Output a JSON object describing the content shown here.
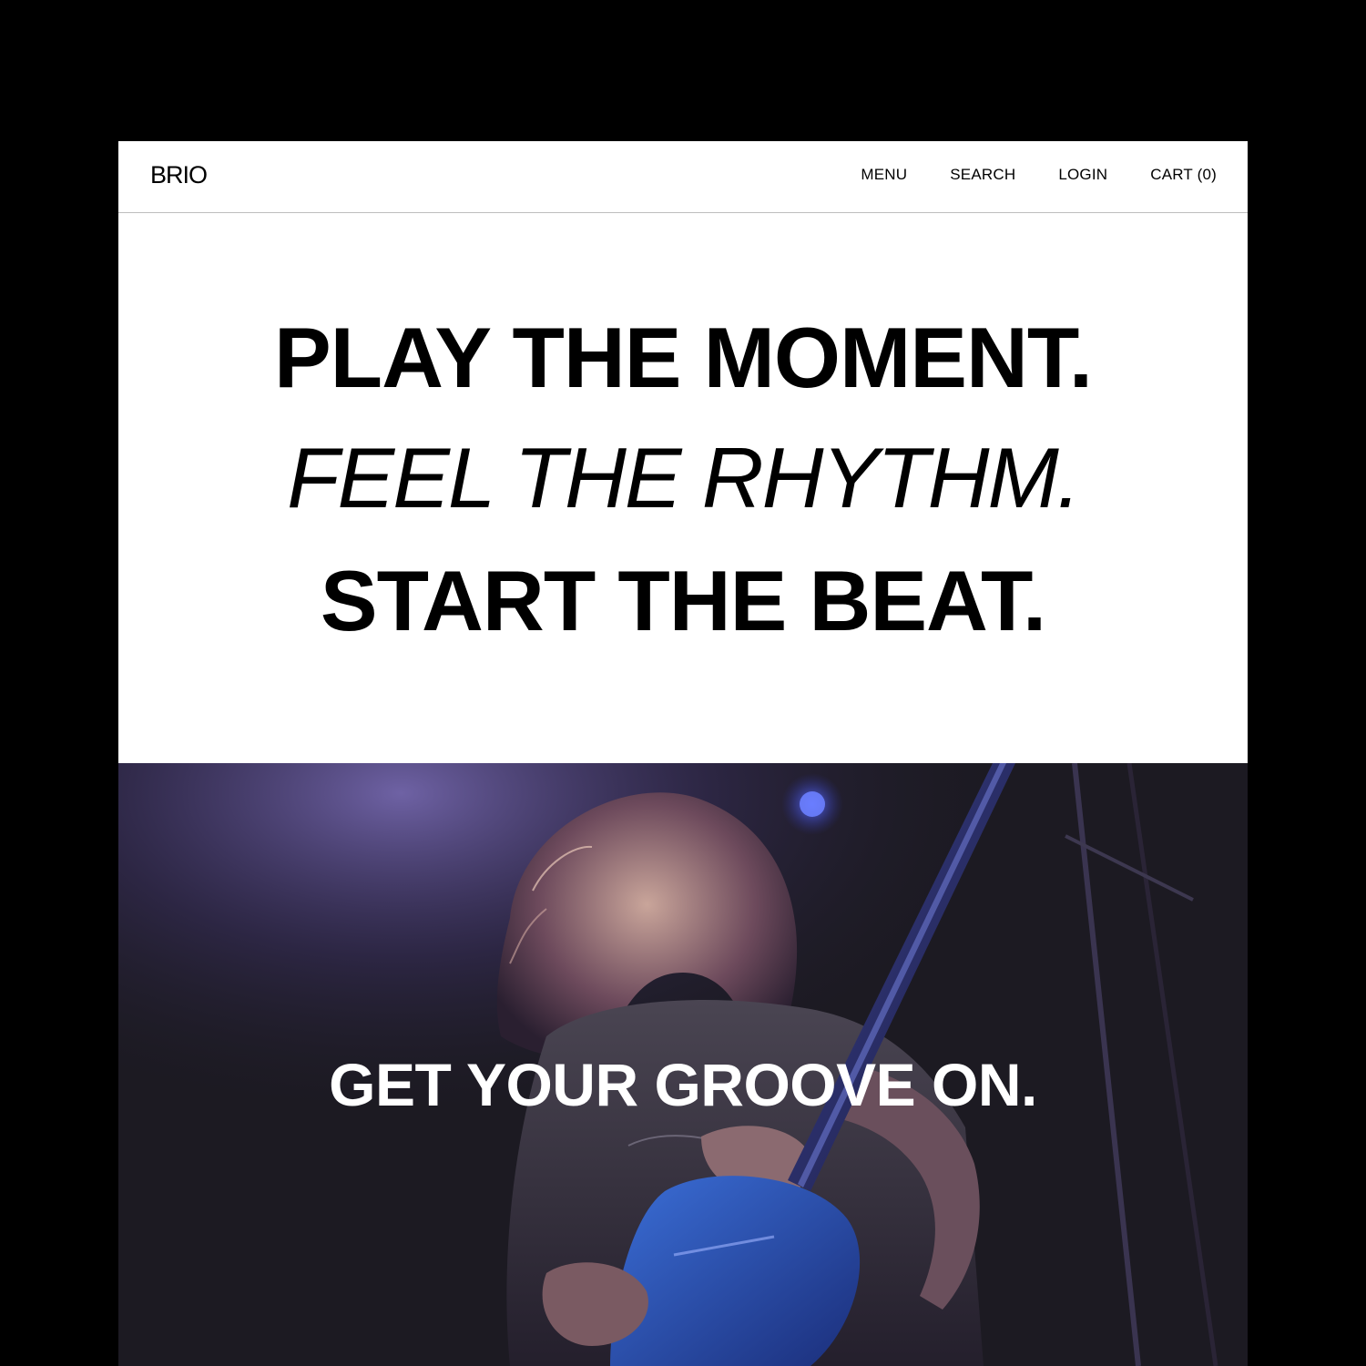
{
  "header": {
    "logo": "BRIO",
    "nav": {
      "menu": "MENU",
      "search": "SEARCH",
      "login": "LOGIN",
      "cart": "CART (0)"
    }
  },
  "hero": {
    "line1": "PLAY THE MOMENT.",
    "line2": "FEEL THE RHYTHM.",
    "line3": "START THE BEAT."
  },
  "banner": {
    "caption": "GET YOUR GROOVE ON."
  },
  "colors": {
    "background": "#000000",
    "page": "#ffffff",
    "text": "#000000",
    "photo_base": "#1c1a22",
    "stage_light": "#6b55c8"
  }
}
